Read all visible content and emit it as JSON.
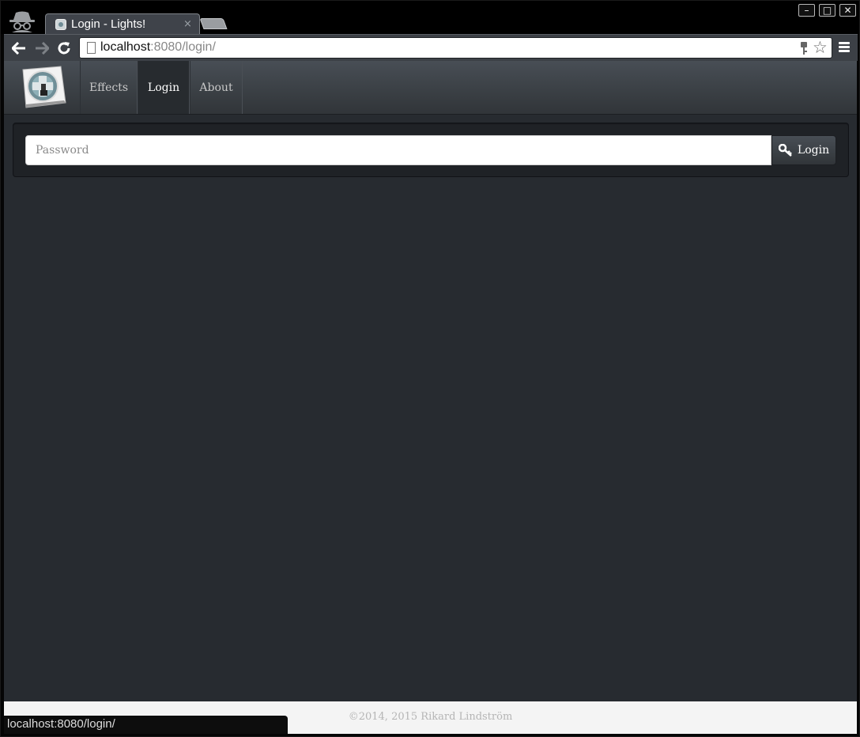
{
  "browser": {
    "tab_title": "Login - Lights!",
    "tab_close": "×",
    "url_host": "localhost",
    "url_rest": ":8080/login/",
    "status_url": "localhost:8080/login/",
    "window_controls": {
      "minimize": "–",
      "maximize": "□",
      "close": "✕"
    }
  },
  "navbar": {
    "items": [
      {
        "label": "Effects",
        "active": false
      },
      {
        "label": "Login",
        "active": true
      },
      {
        "label": "About",
        "active": false
      }
    ]
  },
  "login_form": {
    "password_placeholder": "Password",
    "password_value": "",
    "submit_label": "Login",
    "submit_icon": "key-icon"
  },
  "footer": {
    "copyright": "©2014, 2015 Rikard Lindström"
  },
  "colors": {
    "page_bg": "#272b30",
    "navbar_bg": "#3a3f44",
    "footer_bg": "#f4f4f4"
  }
}
